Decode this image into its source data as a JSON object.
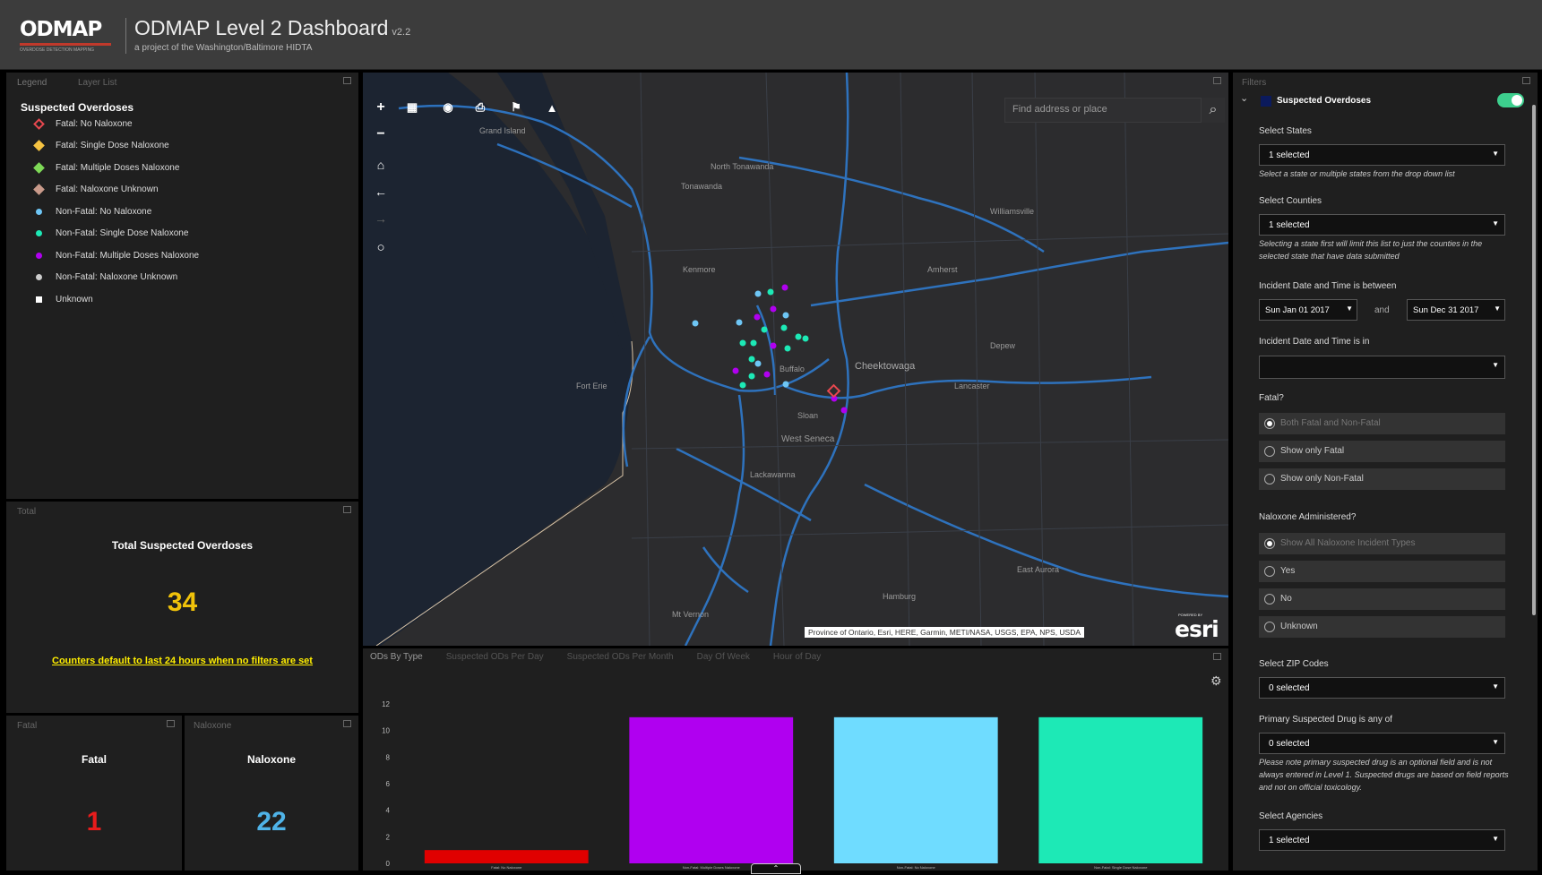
{
  "header": {
    "logo_text": "ODMAP",
    "logo_sub": "OVERDOSE DETECTION MAPPING APPLICATION PROGRAM",
    "title": "ODMAP Level 2 Dashboard",
    "version": "v2.2",
    "subtitle": "a project of the Washington/Baltimore HIDTA"
  },
  "legend_panel": {
    "tabs": [
      "Legend",
      "Layer List"
    ],
    "heading": "Suspected Overdoses",
    "items": [
      {
        "label": "Fatal: No Naloxone",
        "symbol": "diamond-outline",
        "color": "#e8484f"
      },
      {
        "label": "Fatal: Single Dose Naloxone",
        "symbol": "diamond",
        "color": "#f5c342"
      },
      {
        "label": "Fatal: Multiple Doses Naloxone",
        "symbol": "diamond",
        "color": "#7ed957"
      },
      {
        "label": "Fatal: Naloxone Unknown",
        "symbol": "diamond",
        "color": "#c99a8a"
      },
      {
        "label": "Non-Fatal: No Naloxone",
        "symbol": "circle",
        "color": "#6ec6f5"
      },
      {
        "label": "Non-Fatal: Single Dose Naloxone",
        "symbol": "circle",
        "color": "#1de9b6"
      },
      {
        "label": "Non-Fatal: Multiple Doses Naloxone",
        "symbol": "circle",
        "color": "#b000f0"
      },
      {
        "label": "Non-Fatal: Naloxone Unknown",
        "symbol": "circle",
        "color": "#cccccc"
      },
      {
        "label": "Unknown",
        "symbol": "square",
        "color": "#ffffff"
      }
    ]
  },
  "total_panel": {
    "tab": "Total",
    "label": "Total Suspected Overdoses",
    "count": "34",
    "note": "Counters default to last 24 hours when no filters are set"
  },
  "fatal_panel": {
    "tab": "Fatal",
    "label": "Fatal",
    "value": "1",
    "value_color": "#e81c1c"
  },
  "naloxone_panel": {
    "tab": "Naloxone",
    "label": "Naloxone",
    "value": "22",
    "value_color": "#4fb3e8"
  },
  "map": {
    "search_placeholder": "Find address or place",
    "attribution": "Province of Ontario, Esri, HERE, Garmin, METI/NASA, USGS, EPA, NPS, USDA",
    "esri_logo": "esri",
    "esri_powered": "POWERED BY",
    "labels": {
      "north_tonawanda": "North Tonawanda",
      "tonawanda": "Tonawanda",
      "buffalo": "Buffalo",
      "cheektowaga": "Cheektowaga",
      "west_seneca": "West Seneca",
      "lackawanna": "Lackawanna",
      "lancaster": "Lancaster",
      "mt_vernon": "Mt Vernon",
      "fort_erie": "Fort Erie",
      "amherst": "Amherst",
      "kenmore": "Kenmore",
      "sloan": "Sloan",
      "depew": "Depew",
      "grand_island": "Grand Island",
      "williamsville": "Williamsville",
      "east_aurora": "East Aurora",
      "hamburg": "Hamburg"
    }
  },
  "chart_panel": {
    "tabs": [
      "ODs By Type",
      "Suspected ODs Per Day",
      "Suspected ODs Per Month",
      "Day Of Week",
      "Hour of Day"
    ],
    "active_tab": 0
  },
  "chart_data": {
    "type": "bar",
    "categories": [
      "Fatal: No Naloxone",
      "Non-Fatal: Multiple Doses Naloxone",
      "Non-Fatal: No Naloxone",
      "Non-Fatal: Single Dose Naloxone"
    ],
    "values": [
      1,
      11,
      11,
      11
    ],
    "colors": [
      "#e00000",
      "#b000f0",
      "#6fdcff",
      "#1de9b6"
    ],
    "yticks": [
      0,
      2,
      4,
      6,
      8,
      10,
      12
    ],
    "ylim": [
      0,
      12
    ],
    "title": "",
    "xlabel": "",
    "ylabel": ""
  },
  "filters": {
    "title": "Filters",
    "layer": "Suspected Overdoses",
    "select_states": {
      "label": "Select States",
      "value": "1 selected",
      "help": "Select a state or multiple states from the drop down list"
    },
    "select_counties": {
      "label": "Select Counties",
      "value": "1 selected",
      "help": "Selecting a state first will limit this list to just the counties in the selected state that have data submitted"
    },
    "date_between": {
      "label": "Incident Date and Time is between",
      "start": "Sun Jan 01 2017",
      "and": "and",
      "end": "Sun Dec 31 2017"
    },
    "date_in": {
      "label": "Incident Date and Time is in",
      "value": ""
    },
    "fatal": {
      "label": "Fatal?",
      "options": [
        "Both Fatal and Non-Fatal",
        "Show only Fatal",
        "Show only Non-Fatal"
      ]
    },
    "naloxone": {
      "label": "Naloxone Administered?",
      "options": [
        "Show All Naloxone Incident Types",
        "Yes",
        "No",
        "Unknown"
      ]
    },
    "zip": {
      "label": "Select ZIP Codes",
      "value": "0 selected"
    },
    "drug": {
      "label": "Primary Suspected Drug is any of",
      "value": "0 selected",
      "help": "Please note primary suspected drug is an optional field and is not always entered in Level 1. Suspected drugs are based on field reports and not on official toxicology."
    },
    "agencies": {
      "label": "Select Agencies",
      "value": "1 selected"
    }
  }
}
